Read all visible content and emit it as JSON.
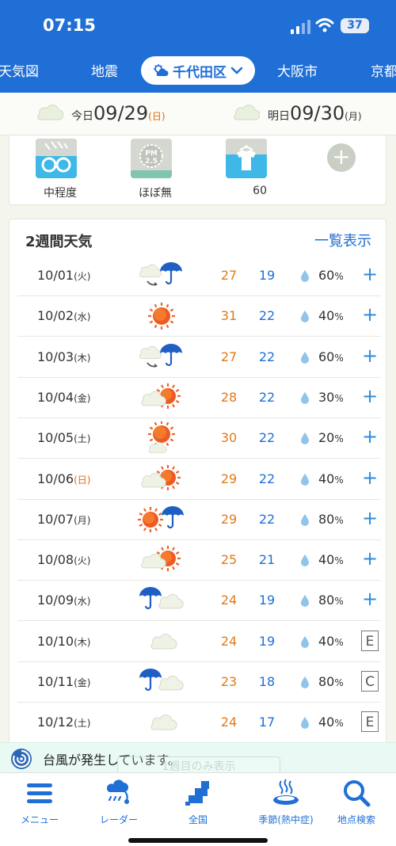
{
  "status_bar": {
    "time": "07:15",
    "battery": "37"
  },
  "nav_tabs": [
    {
      "label": "天気図"
    },
    {
      "label": "地震"
    },
    {
      "label": "千代田区",
      "active": true
    },
    {
      "label": "大阪市"
    },
    {
      "label": "京都"
    }
  ],
  "date_bar": {
    "today": {
      "label": "今日",
      "date": "09/29",
      "weekday": "(日)"
    },
    "tomorrow": {
      "label": "明日",
      "date": "09/30",
      "weekday": "(月)"
    }
  },
  "indices": [
    {
      "name": "pollen",
      "icon": "pollen-glasses-icon",
      "caption": "中程度"
    },
    {
      "name": "pm25",
      "icon": "pm25-icon",
      "caption": "ほぼ無"
    },
    {
      "name": "laundry",
      "icon": "laundry-shirt-icon",
      "caption": "60"
    }
  ],
  "add_index_label": "+",
  "two_week": {
    "title": "2週間天気",
    "list_link": "一覧表示",
    "rows": [
      {
        "date": "10/01",
        "wd": "(火)",
        "icon": "cloud-then-rain-icon",
        "hi": "27",
        "lo": "19",
        "pct": "60",
        "unit": "%",
        "action": "+"
      },
      {
        "date": "10/02",
        "wd": "(水)",
        "icon": "sun-icon",
        "hi": "31",
        "lo": "22",
        "pct": "40",
        "unit": "%",
        "action": "+"
      },
      {
        "date": "10/03",
        "wd": "(木)",
        "icon": "cloud-then-rain-icon",
        "hi": "27",
        "lo": "22",
        "pct": "60",
        "unit": "%",
        "action": "+"
      },
      {
        "date": "10/04",
        "wd": "(金)",
        "icon": "cloud-sun-icon",
        "hi": "28",
        "lo": "22",
        "pct": "30",
        "unit": "%",
        "action": "+"
      },
      {
        "date": "10/05",
        "wd": "(土)",
        "icon": "sun-cloud-icon",
        "hi": "30",
        "lo": "22",
        "pct": "20",
        "unit": "%",
        "action": "+"
      },
      {
        "date": "10/06",
        "wd": "(日)",
        "icon": "cloud-sun-icon",
        "hi": "29",
        "lo": "22",
        "pct": "40",
        "unit": "%",
        "action": "+"
      },
      {
        "date": "10/07",
        "wd": "(月)",
        "icon": "sun-rain-icon",
        "hi": "29",
        "lo": "22",
        "pct": "80",
        "unit": "%",
        "action": "+"
      },
      {
        "date": "10/08",
        "wd": "(火)",
        "icon": "cloud-sun-icon",
        "hi": "25",
        "lo": "21",
        "pct": "40",
        "unit": "%",
        "action": "+"
      },
      {
        "date": "10/09",
        "wd": "(水)",
        "icon": "rain-cloud-icon",
        "hi": "24",
        "lo": "19",
        "pct": "80",
        "unit": "%",
        "action": "+"
      },
      {
        "date": "10/10",
        "wd": "(木)",
        "icon": "cloud-icon",
        "hi": "24",
        "lo": "19",
        "pct": "40",
        "unit": "%",
        "action": "E"
      },
      {
        "date": "10/11",
        "wd": "(金)",
        "icon": "rain-cloud-icon",
        "hi": "23",
        "lo": "18",
        "pct": "80",
        "unit": "%",
        "action": "C"
      },
      {
        "date": "10/12",
        "wd": "(土)",
        "icon": "cloud-icon",
        "hi": "24",
        "lo": "17",
        "pct": "40",
        "unit": "%",
        "action": "E"
      }
    ]
  },
  "banner": {
    "text": "台風が発生しています。",
    "ghost_text": "1週目のみ表示"
  },
  "bottom_nav": [
    {
      "label": "メニュー",
      "icon": "menu-icon"
    },
    {
      "label": "レーダー",
      "icon": "radar-icon"
    },
    {
      "label": "全国",
      "icon": "national-map-icon"
    },
    {
      "label": "季節(熱中症)",
      "icon": "hot-spring-icon"
    },
    {
      "label": "地点検索",
      "icon": "search-icon"
    }
  ],
  "colors": {
    "primary": "#1f6fd6",
    "high_temp": "#e07a1a",
    "low_temp": "#1f6fd6",
    "sunday": "#e06a10"
  }
}
